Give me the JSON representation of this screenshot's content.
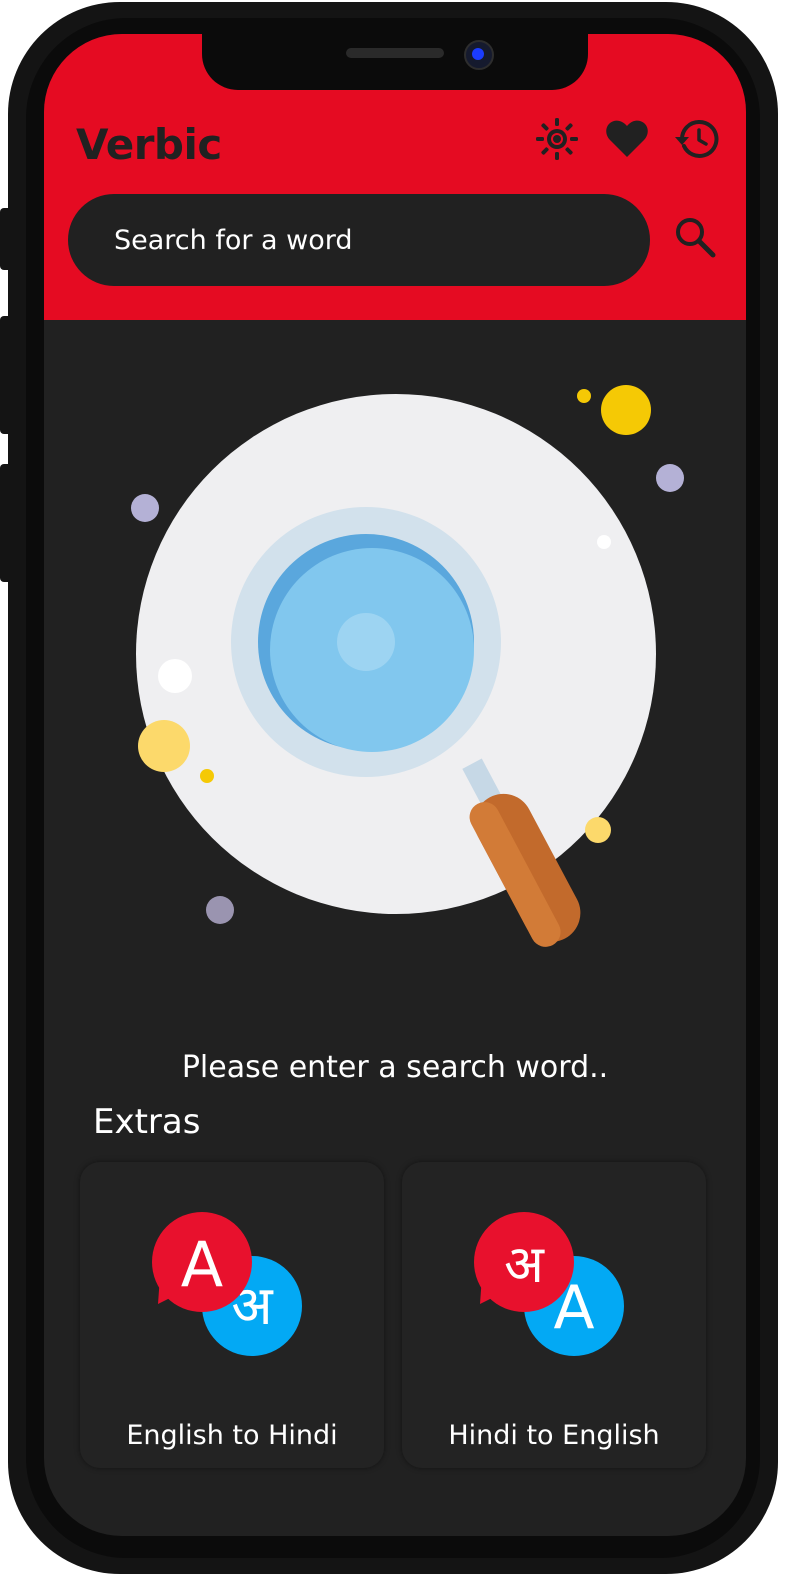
{
  "app": {
    "title": "Verbic"
  },
  "header": {
    "icons": [
      "brightness-icon",
      "favorites-heart-icon",
      "history-icon"
    ]
  },
  "search": {
    "placeholder": "Search for a word",
    "value": "",
    "button_icon": "search-icon"
  },
  "main": {
    "empty_message": "Please enter a search word.."
  },
  "extras": {
    "heading": "Extras",
    "cards": [
      {
        "label": "English to Hindi",
        "front_glyph": "A",
        "back_glyph": "अ",
        "front_color": "#e8112d",
        "back_color": "#03a9f4"
      },
      {
        "label": "Hindi to English",
        "front_glyph": "अ",
        "back_glyph": "A",
        "front_color": "#e8112d",
        "back_color": "#03a9f4"
      }
    ]
  },
  "colors": {
    "header": "#e50b22",
    "background": "#212121",
    "text": "#ffffff"
  }
}
